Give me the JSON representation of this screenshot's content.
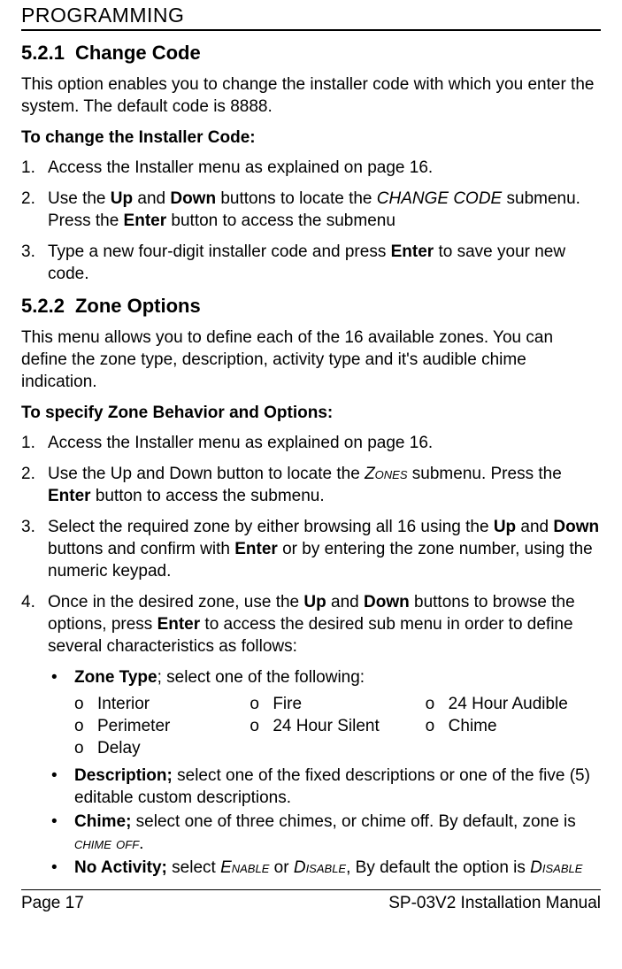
{
  "header": "PROGRAMMING",
  "s1": {
    "num": "5.2.1",
    "title": "Change Code",
    "intro": "This option enables you to change the installer code with which you enter the system. The default code is 8888.",
    "procHead": "To change the Installer Code:",
    "steps": [
      {
        "n": "1.",
        "text": "Access the Installer menu as explained on page 16."
      },
      {
        "n": "2.",
        "pre": "Use the ",
        "b1": "Up",
        "mid1": " and ",
        "b2": "Down",
        "mid2": " buttons to locate the ",
        "it": "CHANGE CODE",
        "mid3": " submenu.  Press the ",
        "b3": "Enter",
        "post": " button to access the submenu"
      },
      {
        "n": "3.",
        "pre": "Type a new four-digit installer code and press ",
        "b1": "Enter",
        "post": " to save your new code."
      }
    ]
  },
  "s2": {
    "num": "5.2.2",
    "title": "Zone Options",
    "intro": "This menu allows you to define each of the 16 available zones. You can define the zone type, description, activity type and it's audible chime indication.",
    "procHead": "To specify Zone Behavior and Options:",
    "steps": [
      {
        "n": "1.",
        "text": "Access the Installer menu as explained on page 16."
      },
      {
        "n": "2.",
        "pre": "Use the Up and Down button to locate the ",
        "sc": "Zones",
        "mid1": " submenu. Press the ",
        "b1": "Enter",
        "post": " button to access the submenu."
      },
      {
        "n": "3.",
        "pre": "Select the required zone by either browsing all 16 using the ",
        "b1": "Up",
        "mid1": " and ",
        "b2": "Down",
        "mid2": " buttons and confirm with ",
        "b3": "Enter",
        "post": " or by entering the zone number, using the numeric keypad."
      },
      {
        "n": "4.",
        "pre": "Once in the desired zone, use the ",
        "b1": "Up",
        "mid1": " and ",
        "b2": "Down",
        "mid2": " buttons to browse the options, press ",
        "b3": "Enter",
        "post": " to access the desired sub menu in order to define several characteristics as follows:"
      }
    ],
    "bullets": {
      "zoneType": {
        "label": "Zone Type",
        "tail": "; select one of the following:"
      },
      "zoneCols": {
        "c1": [
          "Interior",
          "Perimeter",
          "Delay"
        ],
        "c2": [
          "Fire",
          "24 Hour Silent"
        ],
        "c3": [
          "24 Hour Audible",
          "Chime"
        ]
      },
      "desc": {
        "label": "Description;",
        "text": " select one of the fixed descriptions or one of the five (5) editable custom descriptions."
      },
      "chime": {
        "label": "Chime;",
        "pre": " select one of three chimes, or chime off. By default, zone is ",
        "sc": "chime off",
        "post": "."
      },
      "noact": {
        "label": "No Activity;",
        "pre": " select ",
        "sc1": "Enable",
        "mid": " or ",
        "sc2": "Disable",
        "mid2": ", By default the option is ",
        "sc3": "Disable"
      }
    }
  },
  "footer": {
    "left": "Page 17",
    "right": "SP-03V2 Installation Manual"
  },
  "glyph": {
    "o": "o",
    "bullet": "•"
  }
}
